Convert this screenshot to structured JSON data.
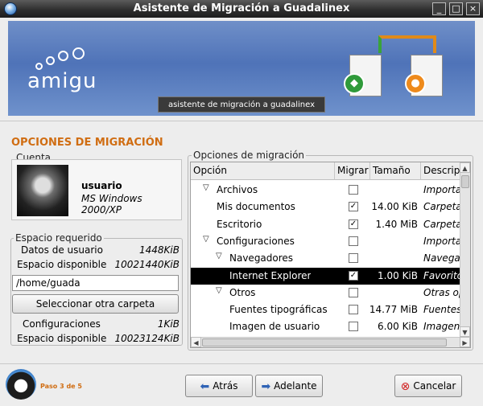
{
  "window": {
    "title": "Asistente de Migración a Guadalinex",
    "controls": {
      "minimize": "_",
      "maximize": "□",
      "close": "×"
    }
  },
  "banner": {
    "brand": "amigu",
    "tagline": "asistente de migración a guadalinex"
  },
  "section_title": "OPCIONES DE MIGRACIÓN",
  "account": {
    "frame_label": "Cuenta",
    "username": "usuario",
    "os": "MS Windows 2000/XP"
  },
  "space": {
    "frame_label": "Espacio requerido",
    "user_data_label": "Datos de usuario",
    "user_data_value": "1448KiB",
    "available_label": "Espacio disponible",
    "available_value": "10021440KiB",
    "path_value": "/home/guada",
    "select_button": "Seleccionar otra carpeta",
    "config_label": "Configuraciones",
    "config_value": "1KiB",
    "available2_label": "Espacio disponible",
    "available2_value": "10023124KiB"
  },
  "options": {
    "frame_label": "Opciones de migración",
    "columns": [
      "Opción",
      "Migrar",
      "Tamaño",
      "Descripció"
    ],
    "rows": [
      {
        "label": "Archivos",
        "expander": "▽",
        "checked": false,
        "size": "",
        "desc": "Importar a"
      },
      {
        "label": "Mis documentos",
        "expander": "",
        "checked": true,
        "size": "14.00 KiB",
        "desc": "Carpeta 'M"
      },
      {
        "label": "Escritorio",
        "expander": "",
        "checked": true,
        "size": "1.40 MiB",
        "desc": "Carpeta 'E"
      },
      {
        "label": "Configuraciones",
        "expander": "▽",
        "checked": false,
        "size": "",
        "desc": "Importar c"
      },
      {
        "label": "Navegadores",
        "expander": "▽",
        "checked": false,
        "size": "",
        "desc": "Navegador"
      },
      {
        "label": "Internet Explorer",
        "expander": "",
        "checked": true,
        "size": "1.00 KiB",
        "desc": "Favoritos d"
      },
      {
        "label": "Otros",
        "expander": "▽",
        "checked": false,
        "size": "",
        "desc": "Otras opci"
      },
      {
        "label": "Fuentes tipográficas",
        "expander": "",
        "checked": false,
        "size": "14.77 MiB",
        "desc": "Fuentes tip"
      },
      {
        "label": "Imagen de usuario",
        "expander": "",
        "checked": false,
        "size": "6.00 KiB",
        "desc": "Imagen de"
      }
    ],
    "selected_row": 5
  },
  "footer": {
    "step": "Paso 3 de 5",
    "back_button": "Atrás",
    "next_button": "Adelante",
    "cancel_button": "Cancelar"
  },
  "colors": {
    "accent": "#d06d12",
    "banner": "#5679bd",
    "selection": "#000000"
  }
}
